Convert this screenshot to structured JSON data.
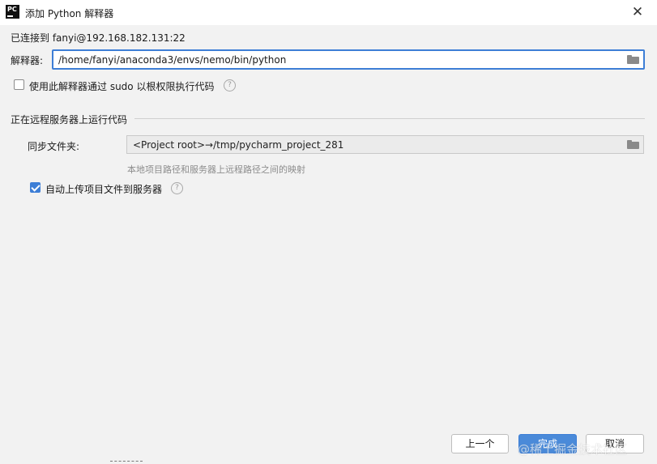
{
  "window": {
    "title": "添加 Python 解释器",
    "app_icon_text": "PC",
    "close_glyph": "✕"
  },
  "connection": {
    "label": "已连接到 fanyi@192.168.182.131:22"
  },
  "interpreter": {
    "label": "解释器:",
    "path": "/home/fanyi/anaconda3/envs/nemo/bin/python"
  },
  "sudo": {
    "label": "使用此解释器通过 sudo 以根权限执行代码",
    "checked": false
  },
  "remote": {
    "section_title": "正在远程服务器上运行代码",
    "sync_label": "同步文件夹:",
    "sync_value": "<Project root>→/tmp/pycharm_project_281",
    "sync_hint": "本地项目路径和服务器上远程路径之间的映射",
    "auto_upload_label": "自动上传项目文件到服务器",
    "auto_upload_checked": true
  },
  "buttons": {
    "prev": "上一个",
    "finish": "完成",
    "cancel": "取消"
  },
  "help_glyph": "?",
  "watermark": "@稀土掘金技术社区",
  "colors": {
    "accent": "#3d7ed6",
    "primary_button": "#4a8ad9",
    "background": "#f2f2f2"
  }
}
